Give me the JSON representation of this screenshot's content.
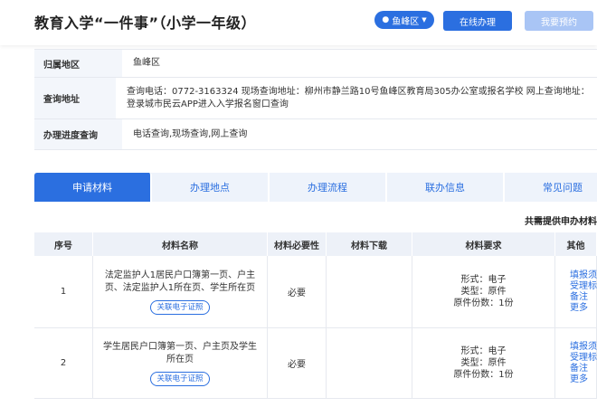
{
  "header": {
    "title": "教育入学“一件事”（小学一年级）",
    "region": "鱼峰区",
    "online_button": "在线办理",
    "book_button": "我要预约"
  },
  "info": [
    {
      "label": "归属地区",
      "value": "鱼峰区"
    },
    {
      "label": "查询地址",
      "value": "查询电话：0772-3163324 现场查询地址：柳州市静兰路10号鱼峰区教育局305办公室或报名学校 网上查询地址：登录城市民云APP进入入学报名窗口查询"
    },
    {
      "label": "办理进度查询",
      "value": "电话查询,现场查询,网上查询"
    }
  ],
  "tabs": [
    {
      "label": "申请材料",
      "active": true
    },
    {
      "label": "办理地点",
      "active": false
    },
    {
      "label": "办理流程",
      "active": false
    },
    {
      "label": "联办信息",
      "active": false
    },
    {
      "label": "常见问题",
      "active": false
    }
  ],
  "total_note": "共需提供申办材料",
  "table": {
    "headers": [
      "序号",
      "材料名称",
      "材料必要性",
      "材料下载",
      "材料要求",
      "其他"
    ],
    "rows": [
      {
        "no": "1",
        "name": "法定监护人1居民户口簿第一页、户主页、法定监护人1所在页、学生所在页",
        "tag": "关联电子证照",
        "required": "必要",
        "download": "",
        "spec": [
          "形式：电子",
          "类型：原件",
          "原件份数：1份"
        ],
        "other": [
          "填报须知",
          "受理标准",
          "备注",
          "更多"
        ]
      },
      {
        "no": "2",
        "name": "学生居民户口簿第一页、户主页及学生所在页",
        "tag": "关联电子证照",
        "required": "必要",
        "download": "",
        "spec": [
          "形式：电子",
          "类型：原件",
          "原件份数：1份"
        ],
        "other": [
          "填报须知",
          "受理标准",
          "备注",
          "更多"
        ]
      }
    ]
  },
  "colors": {
    "primary": "#2b6fe0",
    "disabled": "#a9c5f5",
    "label_bg": "#f3f6fb",
    "tab_bg": "#eef3fb"
  }
}
